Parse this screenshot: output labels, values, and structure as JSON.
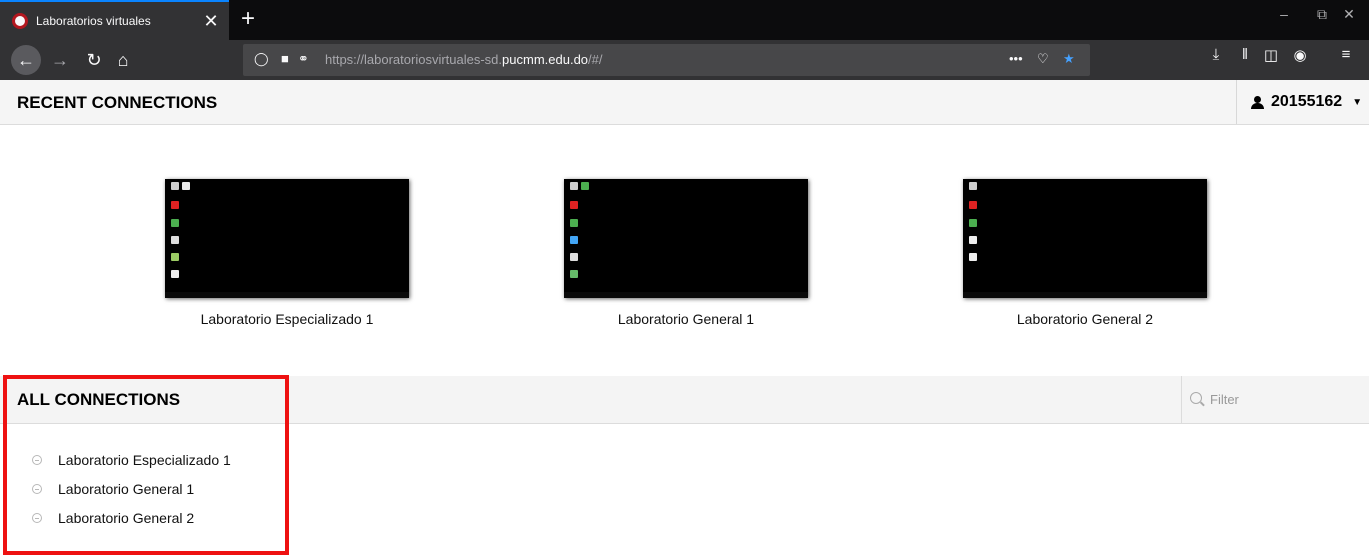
{
  "browser": {
    "tab_title": "Laboratorios virtuales",
    "tab_close": "✕",
    "new_tab": "+",
    "url_prefix": "https://laboratoriosvirtuales-sd.",
    "url_domain": "pucmm.edu.do",
    "url_suffix": "/#/",
    "more": "•••",
    "accent": "#0a84ff"
  },
  "header": {
    "title": "RECENT CONNECTIONS",
    "username": "20155162"
  },
  "recent": [
    {
      "label": "Laboratorio Especializado 1"
    },
    {
      "label": "Laboratorio General 1"
    },
    {
      "label": "Laboratorio General 2"
    }
  ],
  "all": {
    "title": "ALL CONNECTIONS",
    "filter_placeholder": "Filter",
    "items": [
      {
        "label": "Laboratorio Especializado 1"
      },
      {
        "label": "Laboratorio General 1"
      },
      {
        "label": "Laboratorio General 2"
      }
    ]
  },
  "highlight_color": "#ee1111"
}
